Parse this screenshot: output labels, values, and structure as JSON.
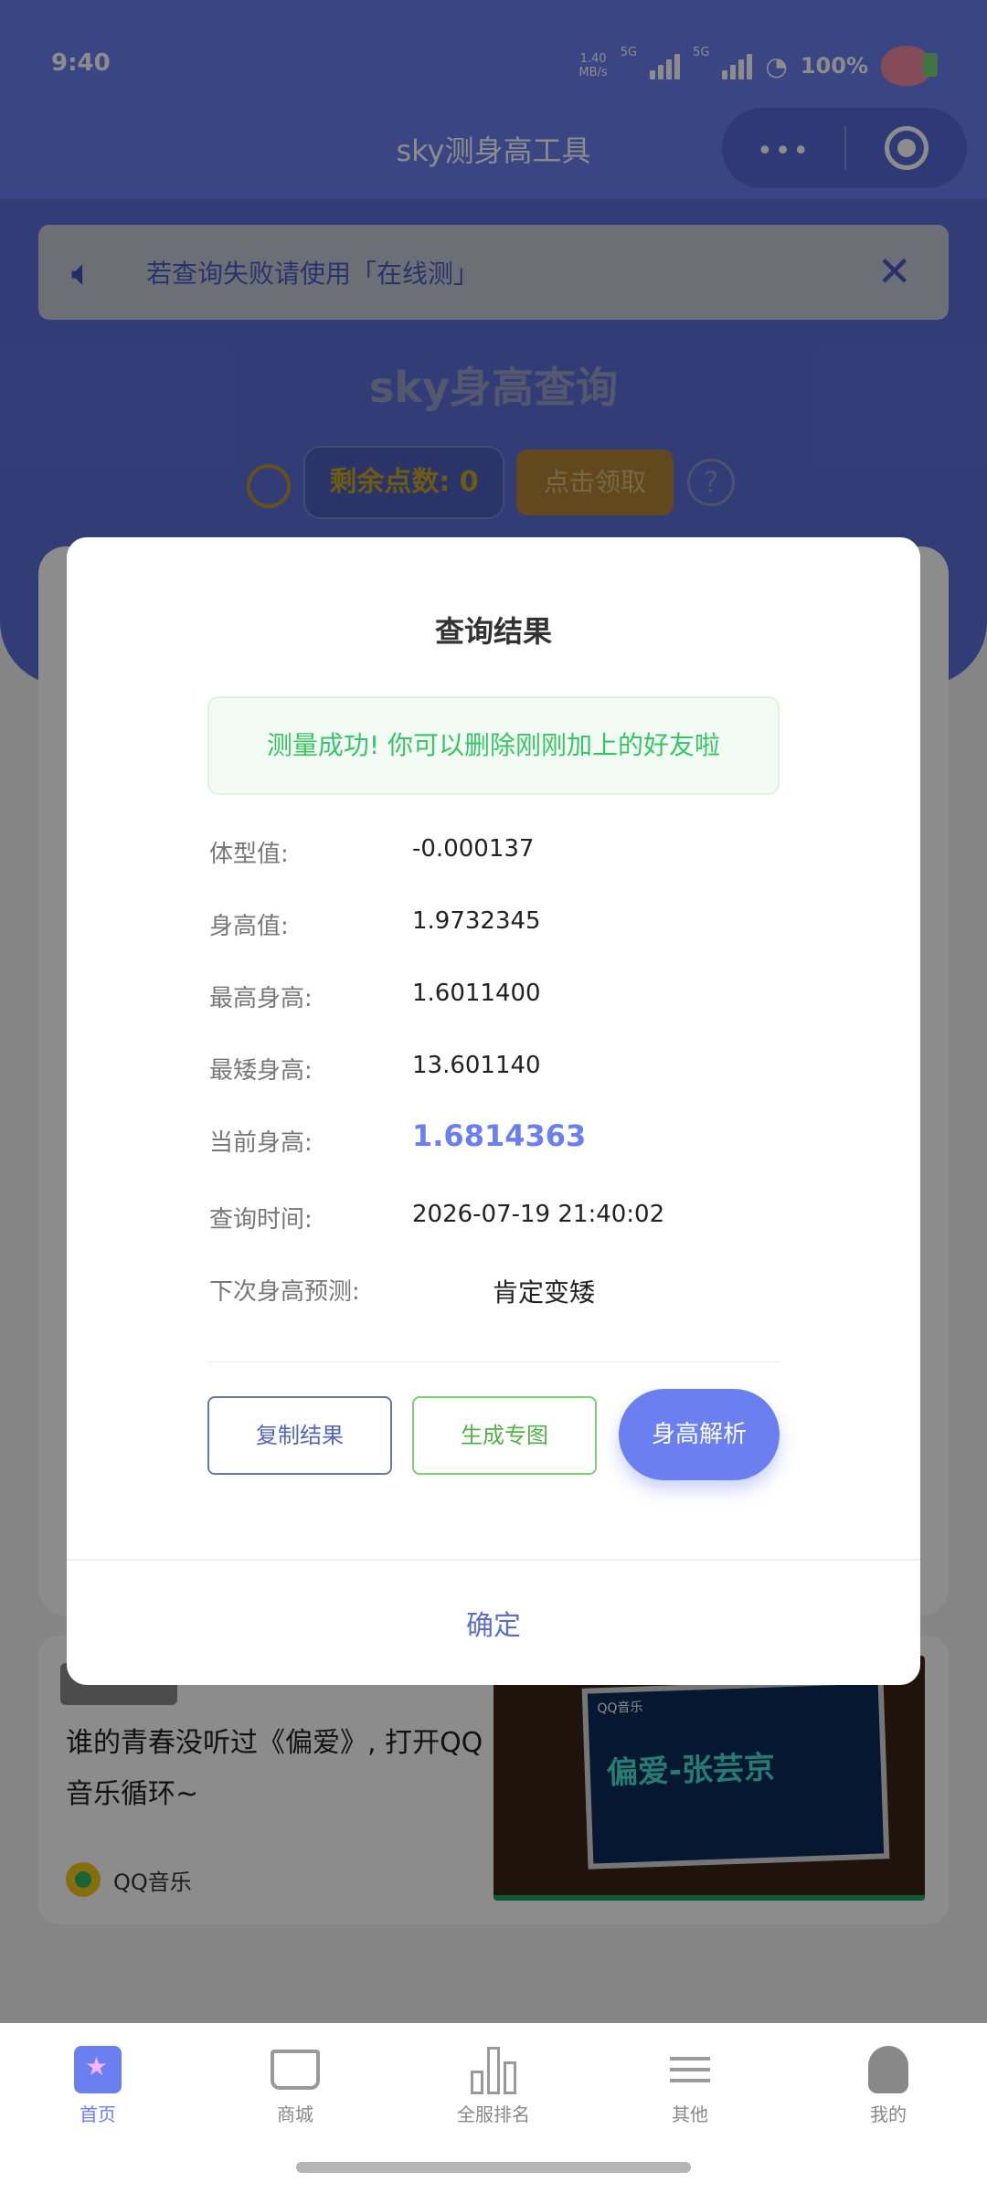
{
  "status_bar": {
    "time": "9:40",
    "net_speed_value": "1.40",
    "net_speed_unit": "MB/s",
    "sim1": "5G",
    "sim2": "5G",
    "battery": "100%"
  },
  "header": {
    "title": "sky测身高工具",
    "menu_dots": "•••"
  },
  "notice": {
    "text": "若查询失败请使用「在线测」",
    "close": "✕"
  },
  "main": {
    "title": "sky身高查询",
    "points_label": "剩余点数: 0",
    "claim_button": "点击领取",
    "help": "?"
  },
  "modal": {
    "title": "查询结果",
    "success_message": "测量成功! 你可以删除刚刚加上的好友啦",
    "rows": [
      {
        "label": "体型值:",
        "value": "-0.000137"
      },
      {
        "label": "身高值:",
        "value": "1.9732345"
      },
      {
        "label": "最高身高:",
        "value": "1.6011400"
      },
      {
        "label": "最矮身高:",
        "value": "13.601140"
      },
      {
        "label": "当前身高:",
        "value": "1.6814363"
      },
      {
        "label": "查询时间:",
        "value": "2026-07-19  21:40:02"
      },
      {
        "label": "下次身高预测:",
        "value": "肯定变矮"
      }
    ],
    "buttons": {
      "copy": "复制结果",
      "generate": "生成专图",
      "analyze": "身高解析"
    },
    "confirm": "确定"
  },
  "feed_card": {
    "text": "谁的青春没听过《偏爱》, 打开QQ 音乐循环~",
    "source": "QQ音乐",
    "thumbnail_caption": "偏爱-张芸京",
    "thumbnail_brand": "QQ音乐"
  },
  "tabbar": {
    "items": [
      {
        "label": "首页",
        "icon": "home-icon",
        "active": true
      },
      {
        "label": "商城",
        "icon": "cart-icon",
        "active": false
      },
      {
        "label": "全服排名",
        "icon": "ranking-icon",
        "active": false
      },
      {
        "label": "其他",
        "icon": "menu-icon",
        "active": false
      },
      {
        "label": "我的",
        "icon": "profile-icon",
        "active": false
      }
    ]
  },
  "colors": {
    "primary": "#6a7ff0",
    "success": "#39c466",
    "claim": "#e6a23c"
  }
}
